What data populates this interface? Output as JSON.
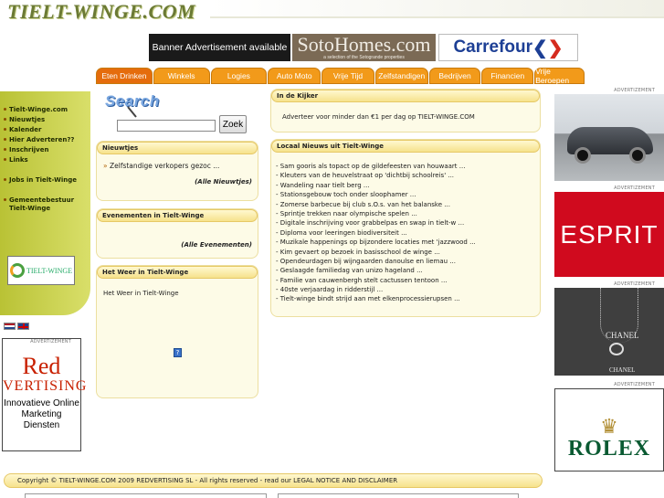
{
  "header": {
    "site_title": "TIELT-WINGE.COM"
  },
  "banners": {
    "ad_text": "Banner Advertisement available",
    "soto_name": "SotoHomes.com",
    "soto_sub": "a selection of the Sotogrande properties",
    "carrefour_name": "Carrefour"
  },
  "nav": {
    "tabs": [
      "Eten Drinken",
      "Winkels",
      "Logies",
      "Auto Moto",
      "Vrije Tijd",
      "Zelfstandigen",
      "Bedrijven",
      "Financien",
      "Vrije Beroepen"
    ]
  },
  "sidebar": {
    "items": [
      "Tielt-Winge.com",
      "Nieuwtjes",
      "Kalender",
      "Hier Adverteren??",
      "Inschrijven",
      "Links"
    ],
    "jobs": "Jobs in Tielt-Winge",
    "muni_line1": "Gemeentebestuur",
    "muni_line2": "Tielt-Winge",
    "logo_text": "TIELT-WINGE"
  },
  "ad_label": "ADVERTIZEMENT",
  "left_ad": {
    "line1": "Red",
    "line2": "VERTISING",
    "text": "Innovatieve Online Marketing Diensten"
  },
  "search": {
    "logo": "Search",
    "input_value": "",
    "button": "Zoek"
  },
  "news_box": {
    "title": "Nieuwtjes",
    "link": "Zelfstandige verkopers gezoc ...",
    "all": "(Alle Nieuwtjes)"
  },
  "events_box": {
    "title": "Evenementen in Tielt-Winge",
    "all": "(Alle Evenementen)"
  },
  "weather_box": {
    "title": "Het Weer in Tielt-Winge",
    "body": "Het Weer in Tielt-Winge",
    "icon_char": "?"
  },
  "kijker": {
    "title": "In de Kijker",
    "text": "Adverteer voor minder dan €1 per dag op TIELT-WINGE.COM"
  },
  "local_news": {
    "title": "Locaal Nieuws uit Tielt-Winge",
    "items": [
      "- Sam gooris als topact op de gildefeesten van houwaart ...",
      "- Kleuters van de heuvelstraat op 'dichtbij schoolreis' ...",
      "- Wandeling naar tielt berg ...",
      "- Stationsgebouw toch onder sloophamer ...",
      "- Zomerse barbecue bij club s.O.s. van het balanske ...",
      "- Sprintje trekken naar olympische spelen ...",
      "- Digitale inschrijving voor grabbelpas en swap in tielt-w ...",
      "- Diploma voor leeringen biodiversiteit ...",
      "- Muzikale happenings op bijzondere locaties met 'jazzwood ...",
      "- Kim gevaert op bezoek in basisschool de winge ...",
      "- Opendeurdagen bij wijngaarden danoulse en liemau ...",
      "- Geslaagde familiedag van unizo hageland ...",
      "- Familie van cauwenbergh stelt cactussen tentoon ...",
      "- 40ste verjaardag in ridderstijl ...",
      "- Tielt-winge bindt strijd aan met elkenprocessierupsen ..."
    ]
  },
  "right_ads": {
    "esprit": "ESPRIT",
    "chanel_top": "CHANEL",
    "chanel_bottom": "CHANEL",
    "rolex": "ROLEX"
  },
  "footer": {
    "text": "Copyright © TIELT-WINGE.COM 2009 REDVERTISING SL - All rights reserved - read our LEGAL NOTICE AND DISCLAIMER"
  }
}
